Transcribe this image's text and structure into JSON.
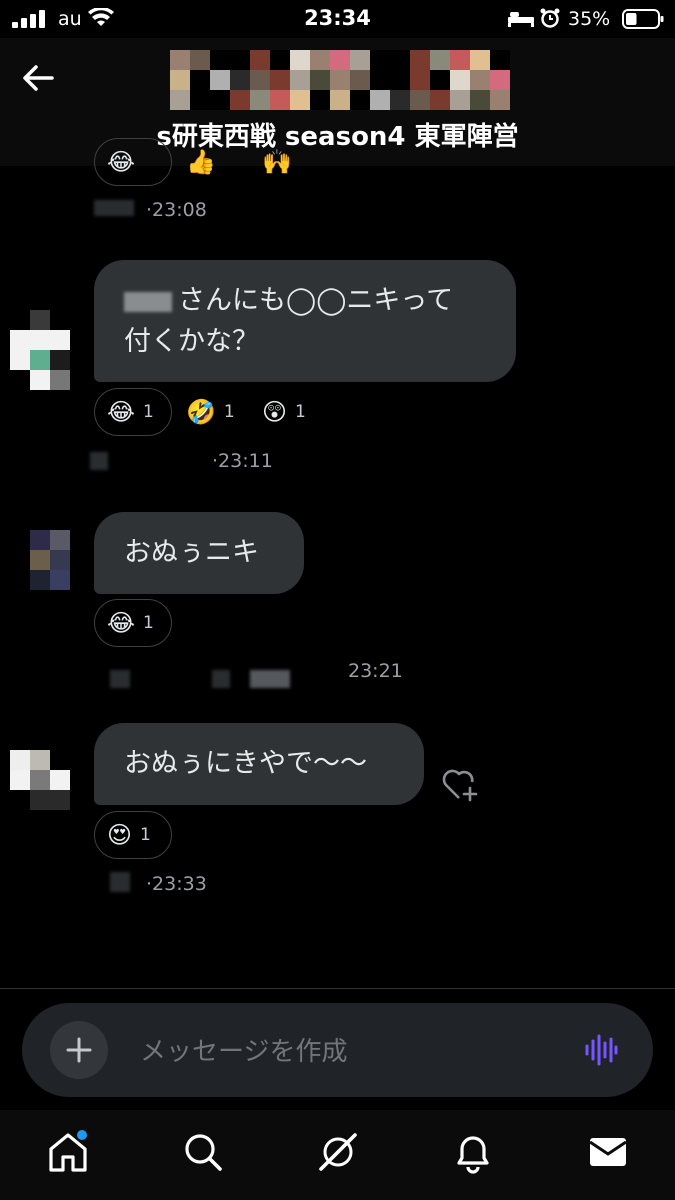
{
  "status_bar": {
    "carrier": "au",
    "time": "23:34",
    "battery_percent": "35%",
    "battery_level": 0.35
  },
  "header": {
    "group_title": "s研東西戦 season4 東軍陣営"
  },
  "messages": [
    {
      "time": "23:08",
      "reactions": []
    },
    {
      "text_line1": "さんにも◯◯ニキって",
      "text_line2": "付くかな？",
      "reactions": [
        {
          "emoji": "😂",
          "count": "1"
        },
        {
          "emoji": "🤣",
          "count": "1"
        },
        {
          "emoji": "😲",
          "count": "1"
        }
      ],
      "time": "23:11"
    },
    {
      "text": "おぬぅニキ",
      "reactions": [
        {
          "emoji": "😂",
          "count": "1"
        }
      ],
      "time": "23:21"
    },
    {
      "text": "おぬぅにきやで〜〜",
      "reactions": [
        {
          "emoji": "😍",
          "count": "1"
        }
      ],
      "time": "23:33"
    }
  ],
  "compose": {
    "placeholder": "メッセージを作成"
  },
  "nav": {
    "items": [
      "home-icon",
      "search-icon",
      "grok-icon",
      "notifications-icon",
      "messages-icon"
    ],
    "accent_color": "#1d9bf0"
  },
  "colors": {
    "accent": "#7856ff",
    "bubble": "#2f3336",
    "background": "#000000"
  }
}
